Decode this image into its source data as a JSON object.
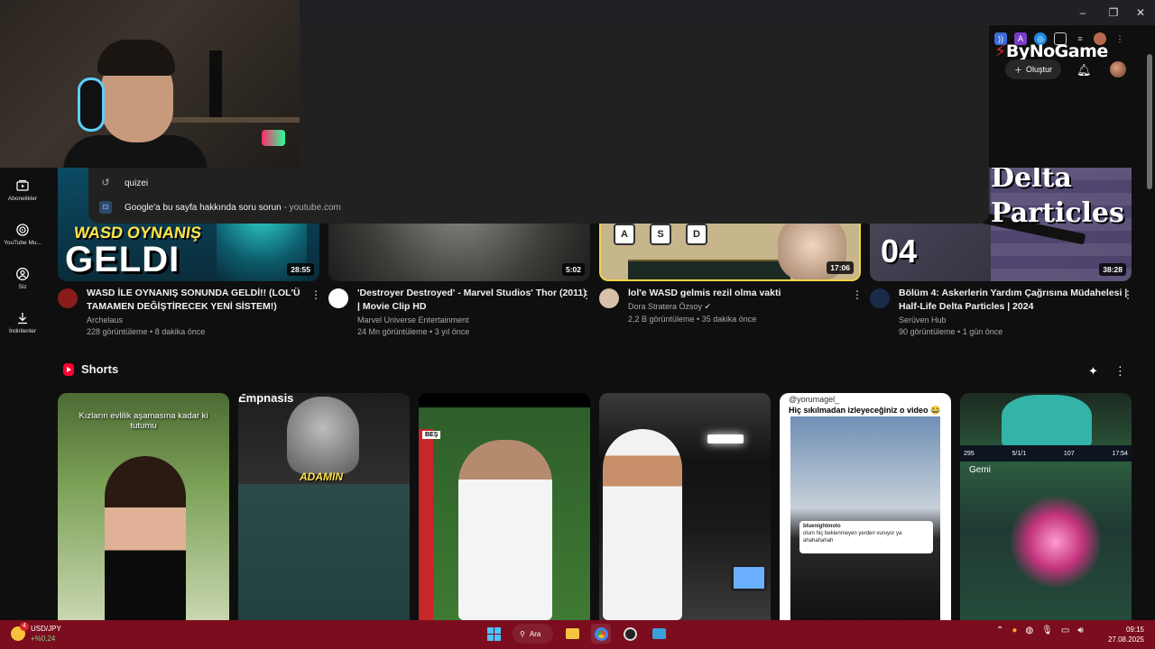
{
  "window": {
    "minimize": "–",
    "maximize": "❐",
    "close": "✕"
  },
  "search_dropdown": {
    "items": [
      {
        "icon": "history-icon",
        "text": "quizei",
        "suffix": ""
      },
      {
        "icon": "google-lens-icon",
        "text": "Google'a bu sayfa hakkında soru sorun",
        "suffix": " - youtube.com"
      }
    ]
  },
  "header": {
    "logo": "ByNoGame",
    "create_label": "Oluştur",
    "create_icon": "plus-icon",
    "notifications_icon": "bell-icon"
  },
  "sidebar": {
    "items": [
      {
        "label": "Abonelikler",
        "icon": "subscriptions-icon"
      },
      {
        "label": "YouTube Mu...",
        "icon": "youtube-music-icon"
      },
      {
        "label": "Siz",
        "icon": "user-icon"
      },
      {
        "label": "İndirilenler",
        "icon": "download-icon"
      }
    ]
  },
  "videos": [
    {
      "title": "WASD İLE OYNANIŞ SONUNDA GELDİ!! (LOL'Ü TAMAMEN DEĞİŞTİRECEK YENİ SİSTEM!)",
      "channel": "Archelaus",
      "stats": "228 görüntüleme • 8 dakika önce",
      "duration": "28:55",
      "thumb_text_1": "WASD OYNANIŞ",
      "thumb_text_2": "GELDI",
      "avatar_color": "#8a1c1c"
    },
    {
      "title": "'Destroyer Destroyed' - Marvel Studios' Thor (2011) | Movie Clip HD",
      "channel": "Marvel Universe Entertainment",
      "stats": "24 Mn görüntüleme • 3 yıl önce",
      "duration": "5:02",
      "avatar_color": "#ffffff"
    },
    {
      "title": "lol'e WASD gelmis rezil olma vakti",
      "channel": "Dora Stratera Özsoy",
      "stats": "2,2 B görüntüleme • 35 dakika önce",
      "duration": "17:06",
      "keys": [
        "A",
        "S",
        "D"
      ],
      "avatar_color": "#d8c1a8"
    },
    {
      "title": "Bölüm 4: Askerlerin Yardım Çağrısına Müdahelesi | Half-Life Delta Particles | 2024",
      "channel": "Serüven Hub",
      "stats": "90 görüntüleme • 1 gün önce",
      "duration": "38:28",
      "thumb_text_1": "Delta Particles",
      "thumb_text_2": "04",
      "avatar_color": "#1c2a4a"
    }
  ],
  "shorts": {
    "title": "Shorts",
    "items": [
      {
        "caption": "Kızların evlilik aşamasına kadar ki tutumu"
      },
      {
        "caption": "Empnasis",
        "overlay": "ADAMIN"
      },
      {
        "tag": "BEŞ"
      },
      {
        "caption": ""
      },
      {
        "handle": "@yorumagel_",
        "caption": "Hiç sıkılmadan izleyeceğiniz o video 😂",
        "comment_user": "bluenightmoto",
        "comment_text": "olum hiç beklenmeyen yerden vuruyor ya ahahahahah"
      },
      {
        "hud_left": "295",
        "hud_mid": "5/1/1",
        "hud_right1": "107",
        "hud_right2": "17:54",
        "caption": "Gemi"
      }
    ]
  },
  "taskbar": {
    "weather_title": "USD/JPY",
    "weather_sub": "+%0,24",
    "search": "Ara",
    "time": "09:15",
    "date": "27.08.2025"
  },
  "colors": {
    "accent": "#ff0033",
    "taskbar": "#7b0d1e",
    "bg": "#0f0f0f"
  }
}
